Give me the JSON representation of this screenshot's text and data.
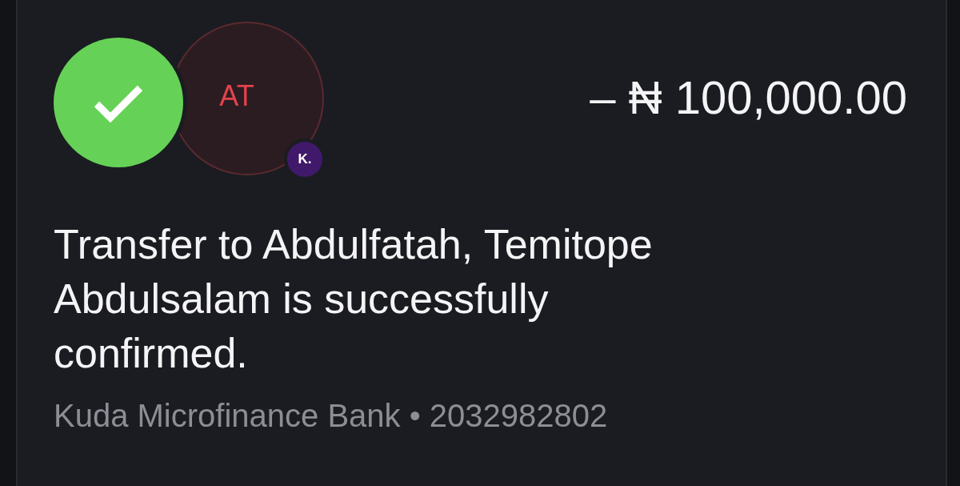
{
  "transaction": {
    "success": true,
    "recipient_initials": "AT",
    "bank_badge": "K.",
    "amount": "– ₦ 100,000.00",
    "message": "Transfer to Abdulfatah, Temitope Abdulsalam is successfully confirmed.",
    "details": "Kuda Microfinance Bank • 2032982802"
  }
}
